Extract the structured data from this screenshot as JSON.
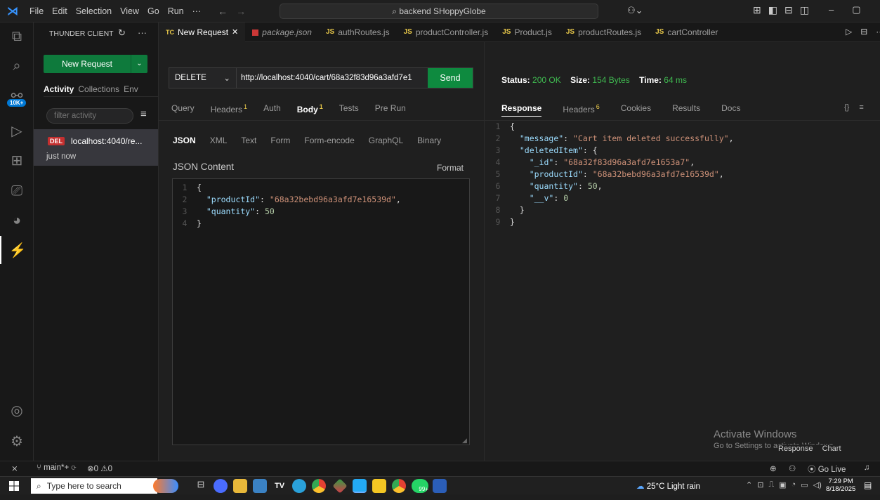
{
  "menu": [
    "File",
    "Edit",
    "Selection",
    "View",
    "Go",
    "Run",
    "···"
  ],
  "search": "backend SHoppyGlobe",
  "sidebar": {
    "title": "THUNDER CLIENT",
    "new_request": "New Request",
    "tabs": [
      "Activity",
      "Collections",
      "Env"
    ],
    "filter_placeholder": "filter activity",
    "item": {
      "method": "DEL",
      "url": "localhost:4040/re...",
      "time": "just now"
    }
  },
  "activity_badge": "10K+",
  "tabs": [
    {
      "label": "New Request",
      "prefix": "TC"
    },
    {
      "label": "package.json",
      "prefix": "pkg"
    },
    {
      "label": "authRoutes.js",
      "prefix": "JS"
    },
    {
      "label": "productController.js",
      "prefix": "JS"
    },
    {
      "label": "Product.js",
      "prefix": "JS"
    },
    {
      "label": "productRoutes.js",
      "prefix": "JS"
    },
    {
      "label": "cartController",
      "prefix": "JS"
    }
  ],
  "request": {
    "method": "DELETE",
    "url": "http://localhost:4040/cart/68a32f83d96a3afd7e1",
    "send": "Send",
    "tabs": [
      "Query",
      "Headers",
      "Auth",
      "Body",
      "Tests",
      "Pre Run"
    ],
    "headers_count": "1",
    "body_count": "1",
    "body_tabs": [
      "JSON",
      "XML",
      "Text",
      "Form",
      "Form-encode",
      "GraphQL",
      "Binary"
    ],
    "content_label": "JSON Content",
    "format": "Format",
    "body_lines": [
      {
        "n": "1",
        "parts": [
          [
            "p",
            "{"
          ]
        ]
      },
      {
        "n": "2",
        "parts": [
          [
            "p",
            "  "
          ],
          [
            "k",
            "\"productId\""
          ],
          [
            "p",
            ": "
          ],
          [
            "s",
            "\"68a32bebd96a3afd7e16539d\""
          ],
          [
            "p",
            ","
          ]
        ]
      },
      {
        "n": "3",
        "parts": [
          [
            "p",
            "  "
          ],
          [
            "k",
            "\"quantity\""
          ],
          [
            "p",
            ": "
          ],
          [
            "n",
            "50"
          ]
        ]
      },
      {
        "n": "4",
        "parts": [
          [
            "p",
            "}"
          ]
        ]
      }
    ]
  },
  "response": {
    "status_label": "Status:",
    "status": "200 OK",
    "size_label": "Size:",
    "size": "154 Bytes",
    "time_label": "Time:",
    "time": "64 ms",
    "tabs": [
      "Response",
      "Headers",
      "Cookies",
      "Results",
      "Docs"
    ],
    "headers_count": "6",
    "braces": "{}",
    "lines": [
      {
        "n": "1",
        "parts": [
          [
            "p",
            "{"
          ]
        ]
      },
      {
        "n": "2",
        "parts": [
          [
            "p",
            "  "
          ],
          [
            "k",
            "\"message\""
          ],
          [
            "p",
            ": "
          ],
          [
            "s",
            "\"Cart item deleted successfully\""
          ],
          [
            "p",
            ","
          ]
        ]
      },
      {
        "n": "3",
        "parts": [
          [
            "p",
            "  "
          ],
          [
            "k",
            "\"deletedItem\""
          ],
          [
            "p",
            ": {"
          ]
        ]
      },
      {
        "n": "4",
        "parts": [
          [
            "p",
            "    "
          ],
          [
            "k",
            "\"_id\""
          ],
          [
            "p",
            ": "
          ],
          [
            "s",
            "\"68a32f83d96a3afd7e1653a7\""
          ],
          [
            "p",
            ","
          ]
        ]
      },
      {
        "n": "5",
        "parts": [
          [
            "p",
            "    "
          ],
          [
            "k",
            "\"productId\""
          ],
          [
            "p",
            ": "
          ],
          [
            "s",
            "\"68a32bebd96a3afd7e16539d\""
          ],
          [
            "p",
            ","
          ]
        ]
      },
      {
        "n": "6",
        "parts": [
          [
            "p",
            "    "
          ],
          [
            "k",
            "\"quantity\""
          ],
          [
            "p",
            ": "
          ],
          [
            "n",
            "50"
          ],
          [
            "p",
            ","
          ]
        ]
      },
      {
        "n": "7",
        "parts": [
          [
            "p",
            "    "
          ],
          [
            "k",
            "\"__v\""
          ],
          [
            "p",
            ": "
          ],
          [
            "n",
            "0"
          ]
        ]
      },
      {
        "n": "8",
        "parts": [
          [
            "p",
            "  }"
          ]
        ]
      },
      {
        "n": "9",
        "parts": [
          [
            "p",
            "}"
          ]
        ]
      }
    ]
  },
  "watermark": {
    "title": "Activate Windows",
    "sub": "Go to Settings to activate Windows.",
    "overlay": "Response",
    "overlay2": "Chart"
  },
  "status": {
    "branch": "main*+",
    "errors": "0",
    "warnings": "0",
    "golive": "Go Live"
  },
  "taskbar": {
    "search": "Type here to search",
    "weather": "25°C  Light rain",
    "time": "7:29 PM",
    "date": "8/18/2025",
    "badge": "99+"
  },
  "colors": {
    "accent": "#0e7a3c",
    "send": "#0e8a3f",
    "status_green": "#3fb950",
    "method_red": "#c53030",
    "blue_link": "#3794ff"
  }
}
